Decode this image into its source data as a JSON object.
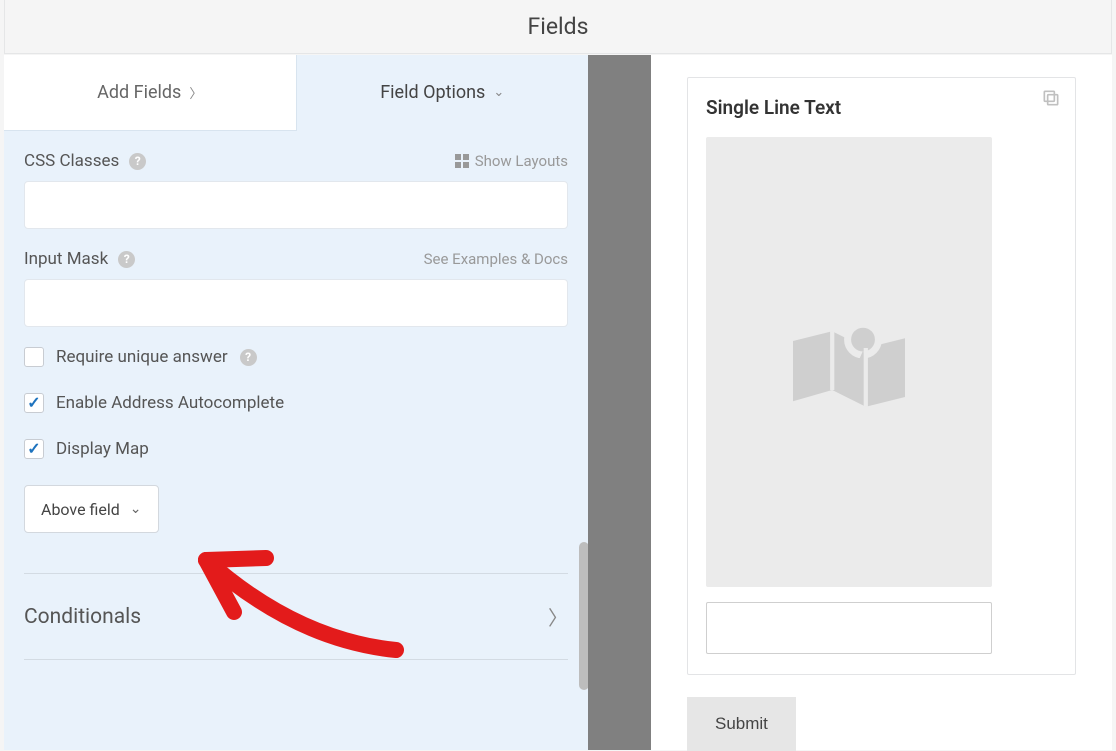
{
  "header": {
    "title": "Fields"
  },
  "tabs": {
    "add_fields": "Add Fields",
    "field_options": "Field Options"
  },
  "options": {
    "css_classes": {
      "label": "CSS Classes",
      "show_layouts": "Show Layouts"
    },
    "input_mask": {
      "label": "Input Mask",
      "see_docs": "See Examples & Docs"
    },
    "require_unique": {
      "label": "Require unique answer",
      "checked": false
    },
    "enable_autocomplete": {
      "label": "Enable Address Autocomplete",
      "checked": true
    },
    "display_map": {
      "label": "Display Map",
      "checked": true
    },
    "map_position_select": {
      "value": "Above field"
    }
  },
  "accordion": {
    "conditionals": "Conditionals"
  },
  "preview": {
    "field_title": "Single Line Text",
    "submit": "Submit"
  }
}
